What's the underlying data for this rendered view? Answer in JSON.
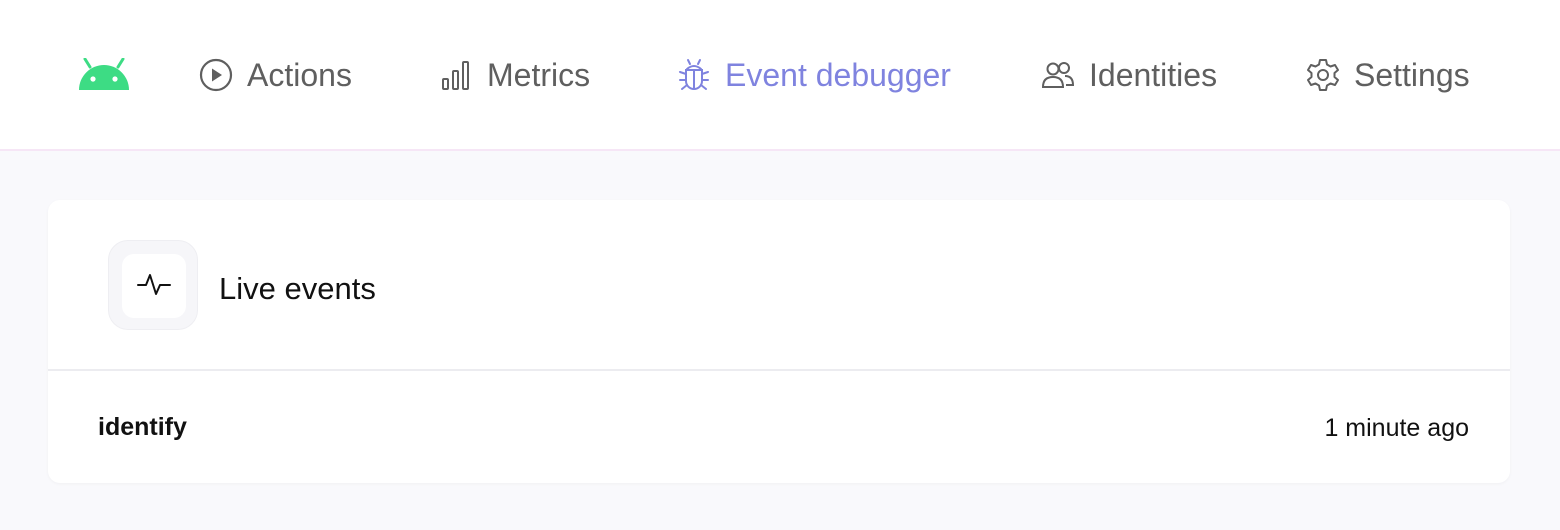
{
  "nav": {
    "items": [
      {
        "label": "Actions",
        "icon": "play-circle-icon"
      },
      {
        "label": "Metrics",
        "icon": "bar-chart-icon"
      },
      {
        "label": "Event debugger",
        "icon": "bug-icon",
        "active": true
      },
      {
        "label": "Identities",
        "icon": "users-icon"
      },
      {
        "label": "Settings",
        "icon": "gear-icon"
      }
    ],
    "active_color": "#7f83df",
    "color": "#5f5f5f"
  },
  "logo": {
    "icon": "android-icon",
    "color": "#3ddc84"
  },
  "live_events": {
    "title": "Live events",
    "icon": "activity-icon",
    "events": [
      {
        "name": "identify",
        "time": "1 minute ago"
      }
    ]
  }
}
